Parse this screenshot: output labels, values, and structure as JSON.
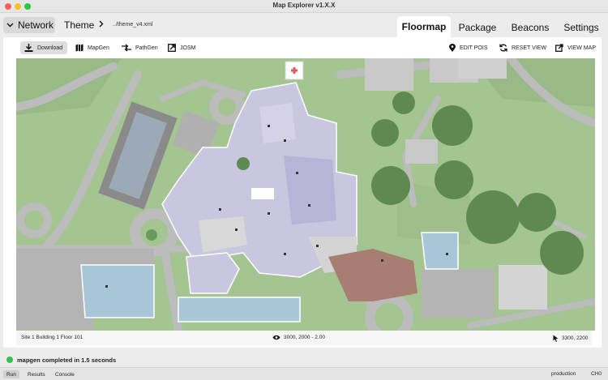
{
  "window": {
    "title": "Map Explorer v1.X.X"
  },
  "nav": {
    "network_label": "Network",
    "theme_label": "Theme",
    "theme_path": "../theme_v4.xml",
    "tabs": [
      {
        "label": "Floormap",
        "active": true
      },
      {
        "label": "Package",
        "active": false
      },
      {
        "label": "Beacons",
        "active": false
      },
      {
        "label": "Settings",
        "active": false
      }
    ]
  },
  "toolbar": {
    "download": "Download",
    "mapgen": "MapGen",
    "pathgen": "PathGen",
    "josm": "JOSM",
    "edit_pois": "EDIT POIS",
    "reset_view": "RESET VIEW",
    "view_map": "VIEW MAP"
  },
  "status": {
    "floor_info": "Site 1   Building 1   Floor 101",
    "view_info": "3000, 2000 - 2.00",
    "cursor_info": "3300, 2200"
  },
  "message": {
    "text": "mapgen completed in 1.5 seconds",
    "color": "#32c24d"
  },
  "bottom": {
    "tabs": [
      {
        "label": "Run",
        "active": true
      },
      {
        "label": "Results",
        "active": false
      },
      {
        "label": "Console",
        "active": false
      }
    ],
    "environment": "production",
    "channel": "CH0"
  },
  "icons": {
    "network_chevron": "chevron-down-icon",
    "theme_arrow": "chevron-right-icon",
    "download": "download-icon",
    "mapgen": "map-icon",
    "pathgen": "path-icon",
    "josm": "external-link-icon",
    "edit_pois": "pin-icon",
    "reset_view": "refresh-icon",
    "view_map": "export-icon",
    "view": "eye-icon",
    "cursor": "cursor-icon",
    "prev": "chevron-left-icon",
    "next": "chevron-right-icon"
  },
  "colors": {
    "map_grass": "#a4c492",
    "map_road": "#b9b9b9",
    "building_purple": "#c9c6e0",
    "building_blue": "#a8c6d8",
    "plaza_red": "#a87d72",
    "tree": "#5e8a52"
  }
}
